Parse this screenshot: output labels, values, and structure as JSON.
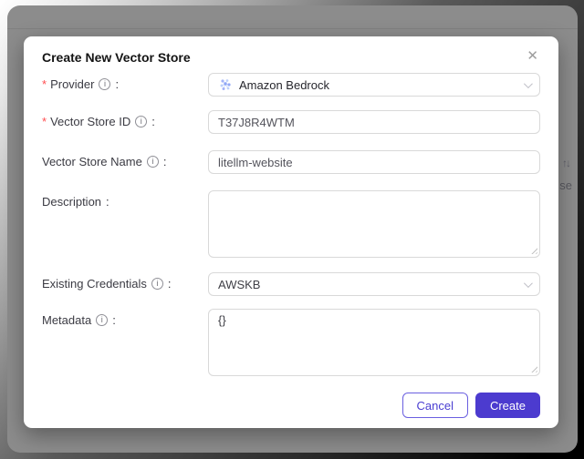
{
  "overlay": {
    "dim_color": "#8c8c8c"
  },
  "background_page": {
    "sort_icon": "↑↓",
    "partial_text": "se"
  },
  "modal": {
    "title": "Create New Vector Store",
    "close_icon": "✕",
    "required_marker": "*",
    "info_glyph": "i",
    "colon": ":",
    "fields": [
      {
        "label": "Provider",
        "required": true,
        "has_info": true,
        "type": "select",
        "value": "Amazon Bedrock",
        "icon": "bedrock-logo"
      },
      {
        "label": "Vector Store ID",
        "required": true,
        "has_info": true,
        "type": "input",
        "value": "T37J8R4WTM"
      },
      {
        "label": "Vector Store Name",
        "required": false,
        "has_info": true,
        "type": "input",
        "value": "litellm-website"
      },
      {
        "label": "Description",
        "required": false,
        "has_info": false,
        "type": "textarea",
        "value": ""
      },
      {
        "label": "Existing Credentials",
        "required": false,
        "has_info": true,
        "type": "select",
        "value": "AWSKB"
      },
      {
        "label": "Metadata",
        "required": false,
        "has_info": true,
        "type": "textarea",
        "value": "{}"
      }
    ],
    "footer": {
      "cancel_label": "Cancel",
      "create_label": "Create"
    },
    "colors": {
      "accent": "#4C3BCF",
      "required_marker_color": "#ff4d4f"
    }
  }
}
